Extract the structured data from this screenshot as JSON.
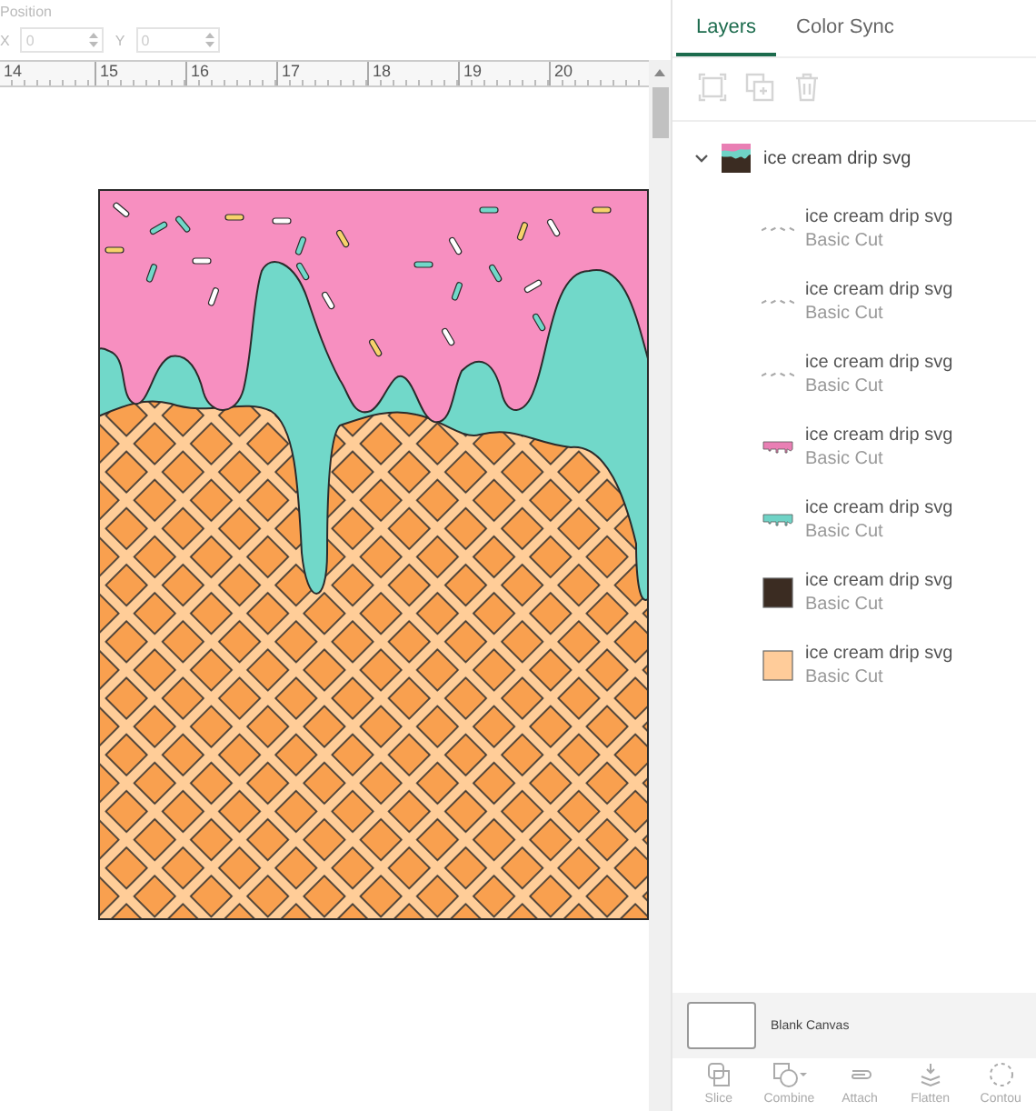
{
  "position": {
    "label": "Position",
    "fields": [
      {
        "label": "X",
        "value": "0",
        "disabled": true
      },
      {
        "label": "Y",
        "value": "0",
        "disabled": true
      }
    ]
  },
  "ruler": {
    "marks": [
      "14",
      "15",
      "16",
      "17",
      "18",
      "19",
      "20"
    ]
  },
  "tabs": [
    {
      "label": "Layers",
      "selected": true
    },
    {
      "label": "Color Sync",
      "selected": false
    }
  ],
  "layer_tools": [
    {
      "kind": "group",
      "disabled": true
    },
    {
      "kind": "duplicate",
      "disabled": true
    },
    {
      "kind": "delete",
      "disabled": true
    }
  ],
  "layer_group": {
    "name": "ice cream drip svg",
    "expanded": true,
    "children": [
      {
        "kind": "sprinkles",
        "name": "ice cream drip svg",
        "operation": "Basic Cut"
      },
      {
        "kind": "sprinkles",
        "name": "ice cream drip svg",
        "operation": "Basic Cut"
      },
      {
        "kind": "sprinkles",
        "name": "ice cream drip svg",
        "operation": "Basic Cut"
      },
      {
        "kind": "drip",
        "color": "#e97fb4",
        "name": "ice cream drip svg",
        "operation": "Basic Cut"
      },
      {
        "kind": "drip",
        "color": "#6fd3c6",
        "name": "ice cream drip svg",
        "operation": "Basic Cut"
      },
      {
        "kind": "square",
        "color": "#3b2c22",
        "name": "ice cream drip svg",
        "operation": "Basic Cut"
      },
      {
        "kind": "square",
        "color": "#ffcc9a",
        "name": "ice cream drip svg",
        "operation": "Basic Cut"
      }
    ]
  },
  "canvas_swatch": {
    "label": "Blank Canvas"
  },
  "bottom_tools": [
    {
      "kind": "slice",
      "label": "Slice",
      "disabled": true
    },
    {
      "kind": "combine",
      "label": "Combine",
      "disabled": true
    },
    {
      "kind": "attach",
      "label": "Attach",
      "disabled": true
    },
    {
      "kind": "flatten",
      "label": "Flatten",
      "disabled": true
    },
    {
      "kind": "contour",
      "label": "Contou",
      "disabled": true
    }
  ]
}
